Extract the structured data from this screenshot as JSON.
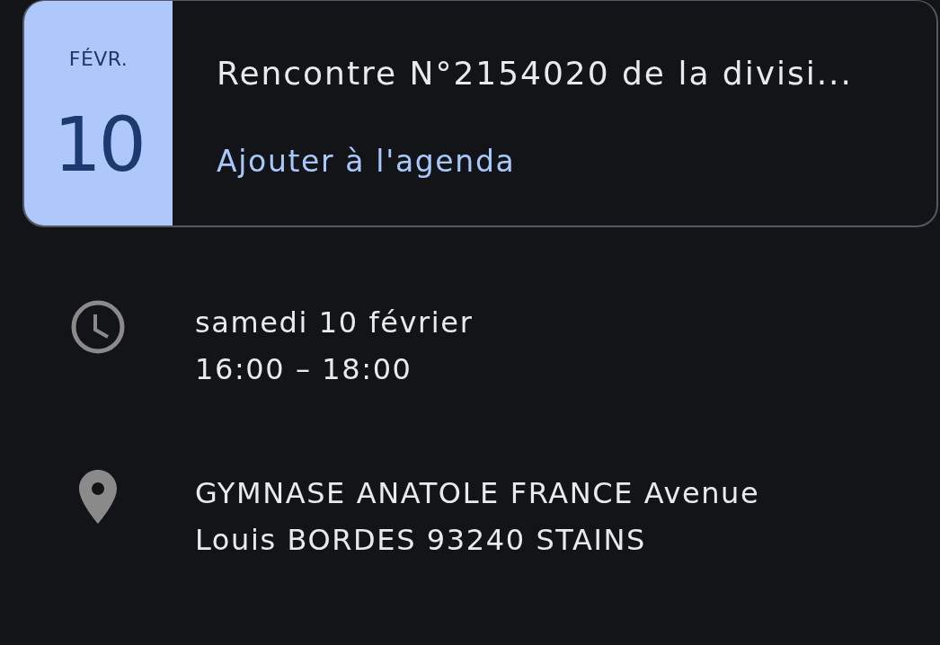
{
  "event_card": {
    "date": {
      "month": "FÉVR.",
      "day": "10"
    },
    "title": "Rencontre N°2154020 de la divisi...",
    "add_link": "Ajouter à l'agenda"
  },
  "details": [
    {
      "kind": "time",
      "lines": [
        "samedi 10 février",
        "16:00 – 18:00"
      ]
    },
    {
      "kind": "location",
      "lines": [
        "GYMNASE ANATOLE FRANCE Avenue",
        "Louis BORDES 93240 STAINS"
      ]
    }
  ]
}
